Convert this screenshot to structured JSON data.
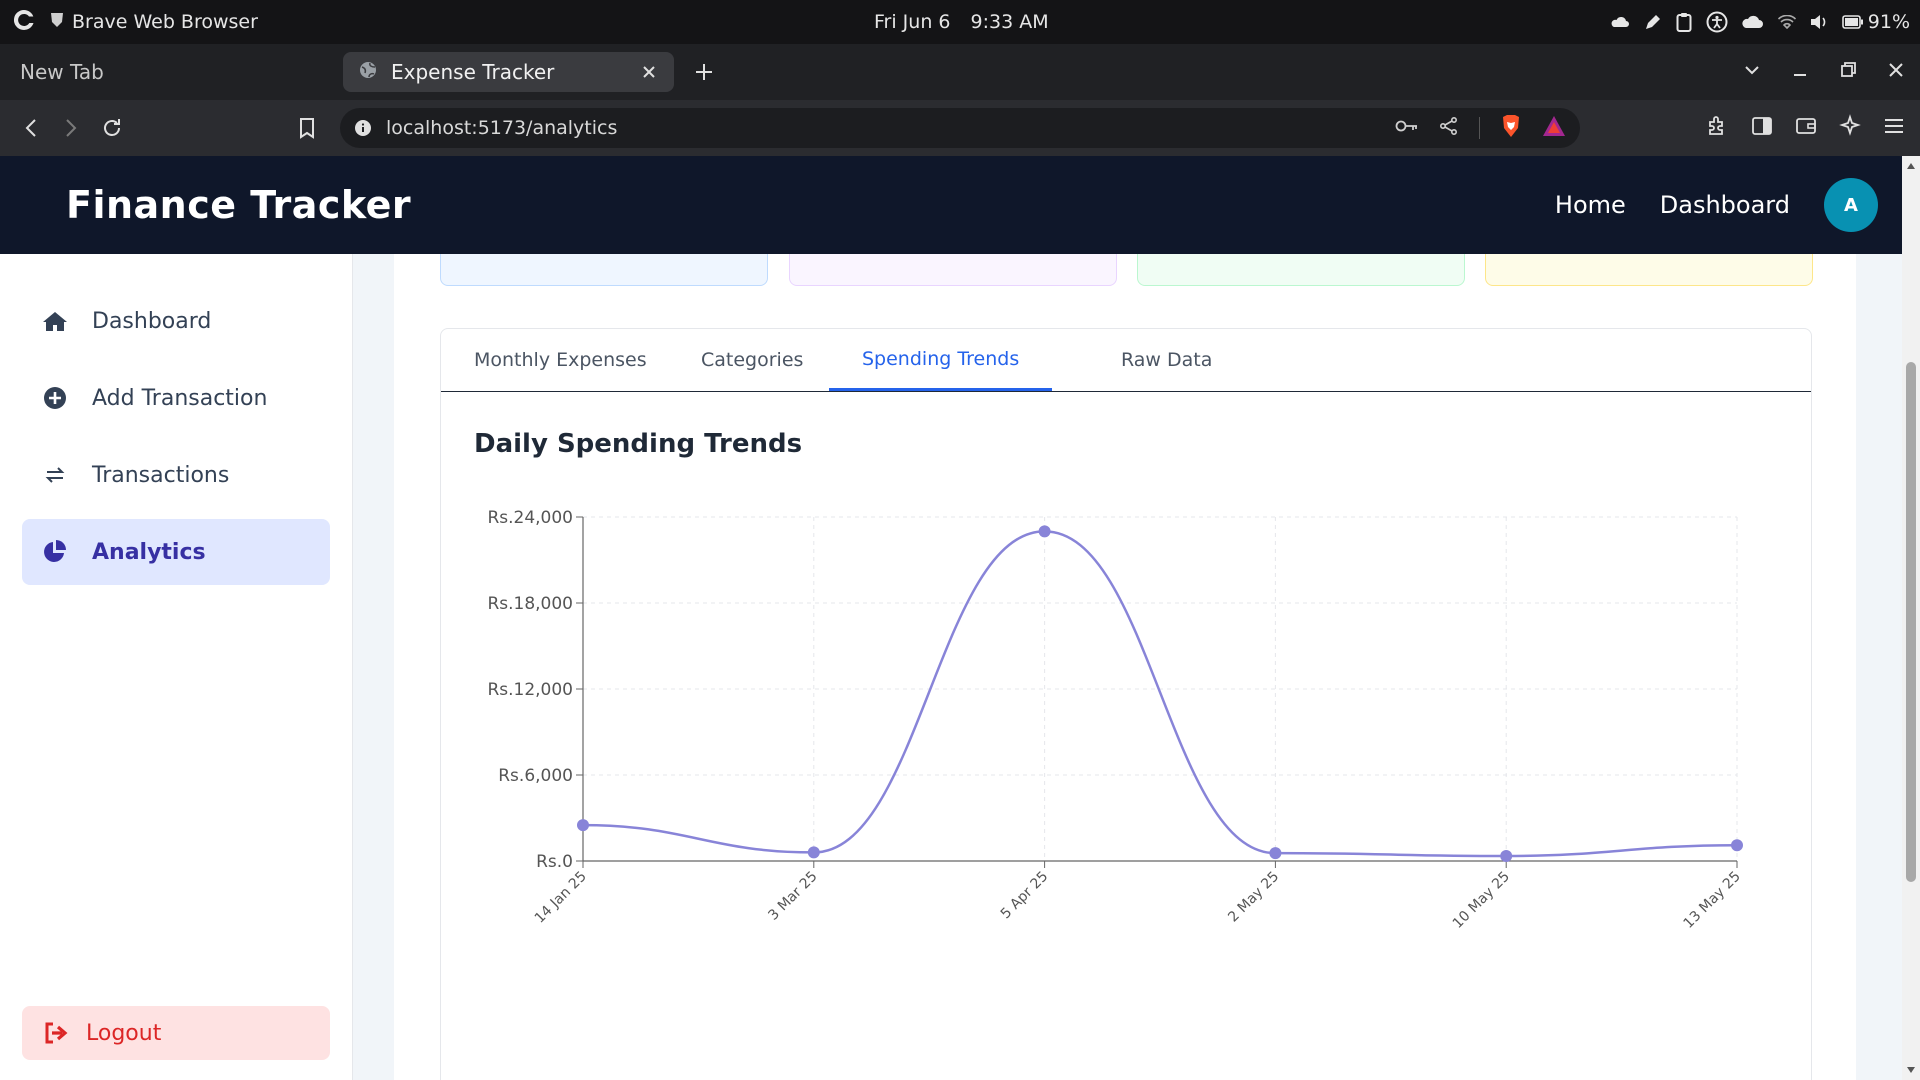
{
  "os": {
    "app_name": "Brave Web Browser",
    "date": "Fri Jun 6",
    "time": "9:33 AM",
    "battery": "91%"
  },
  "browser": {
    "tabs": [
      {
        "title": "New Tab"
      },
      {
        "title": "Expense Tracker",
        "active": true
      }
    ],
    "url": "localhost:5173/analytics"
  },
  "header": {
    "brand": "Finance Tracker",
    "nav": [
      "Home",
      "Dashboard"
    ],
    "avatar_initial": "A"
  },
  "sidebar": {
    "items": [
      {
        "label": "Dashboard",
        "icon": "home-icon"
      },
      {
        "label": "Add Transaction",
        "icon": "plus-circle-icon"
      },
      {
        "label": "Transactions",
        "icon": "exchange-icon"
      },
      {
        "label": "Analytics",
        "icon": "pie-chart-icon",
        "active": true
      }
    ],
    "logout": "Logout"
  },
  "stat_cards": [
    {
      "bg": "#eff6ff",
      "border": "#bfdbfe"
    },
    {
      "bg": "#faf5ff",
      "border": "#e9d5ff"
    },
    {
      "bg": "#f0fdf4",
      "border": "#bbf7d0"
    },
    {
      "bg": "#fefce8",
      "border": "#fde68a"
    }
  ],
  "content": {
    "tabs": [
      "Monthly Expenses",
      "Categories",
      "Spending Trends",
      "Raw Data"
    ],
    "active_tab": "Spending Trends",
    "title": "Daily Spending Trends"
  },
  "colors": {
    "accent": "#2563eb",
    "line": "#8884d8",
    "header_bg": "#0f172a"
  },
  "chart_data": {
    "type": "line",
    "title": "Daily Spending Trends",
    "x": [
      "14 Jan 25",
      "3 Mar 25",
      "5 Apr 25",
      "2 May 25",
      "10 May 25",
      "13 May 25"
    ],
    "series": [
      {
        "values": [
          2500,
          600,
          23000,
          550,
          350,
          1100
        ]
      }
    ],
    "y_ticks": [
      "Rs.0",
      "Rs.6,000",
      "Rs.12,000",
      "Rs.18,000",
      "Rs.24,000"
    ],
    "ylim": [
      0,
      24000
    ],
    "grid": true,
    "curve": "smooth"
  }
}
